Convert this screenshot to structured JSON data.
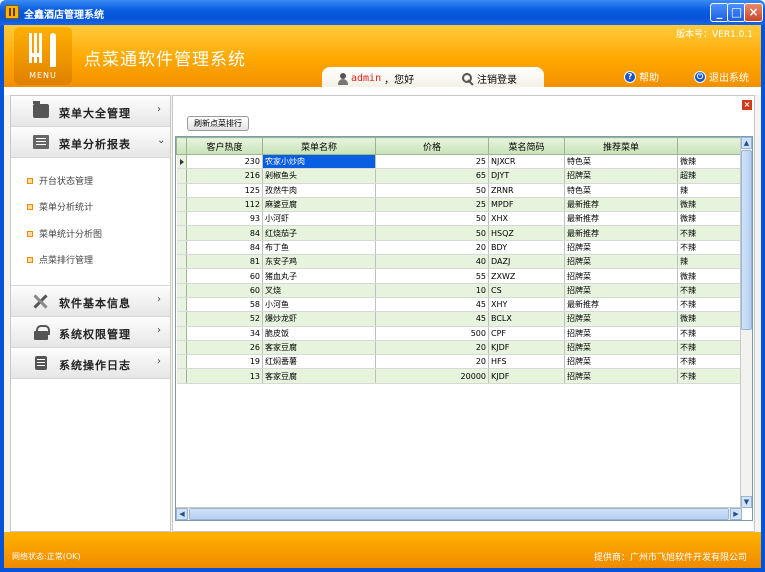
{
  "window": {
    "title": "全鑫酒店管理系统",
    "min": "_",
    "max": "□",
    "close": "×"
  },
  "header": {
    "app_title": "点菜通软件管理系统",
    "version": "版本号：VER1.0.1",
    "user_name": "admin",
    "user_greeting": "，您好",
    "logout": "注销登录",
    "help": "帮助",
    "exit": "退出系统",
    "logo_text": "MENU"
  },
  "sidebar": {
    "sections": [
      {
        "label": "菜单大全管理",
        "chevron": "›"
      },
      {
        "label": "菜单分析报表",
        "chevron": "⌄"
      },
      {
        "label": "软件基本信息",
        "chevron": "›"
      },
      {
        "label": "系统权限管理",
        "chevron": "›"
      },
      {
        "label": "系统操作日志",
        "chevron": "›"
      }
    ],
    "sub_items": [
      "开台状态管理",
      "菜单分析统计",
      "菜单统计分析图",
      "点菜排行管理"
    ]
  },
  "main": {
    "refresh_button": "刷新点菜排行",
    "close": "×",
    "columns": [
      "客户热度",
      "菜单名称",
      "价格",
      "菜名简码",
      "推荐菜单",
      ""
    ],
    "rows": [
      [
        "230",
        "农家小炒肉",
        "25",
        "NJXCR",
        "特色菜",
        "微辣"
      ],
      [
        "216",
        "剁椒鱼头",
        "65",
        "DJYT",
        "招牌菜",
        "超辣"
      ],
      [
        "125",
        "孜然牛肉",
        "50",
        "ZRNR",
        "特色菜",
        "辣"
      ],
      [
        "112",
        "麻婆豆腐",
        "25",
        "MPDF",
        "最新推荐",
        "微辣"
      ],
      [
        "93",
        "小河虾",
        "50",
        "XHX",
        "最新推荐",
        "微辣"
      ],
      [
        "84",
        "红烧茄子",
        "50",
        "HSQZ",
        "最新推荐",
        "不辣"
      ],
      [
        "84",
        "布丁鱼",
        "20",
        "BDY",
        "招牌菜",
        "不辣"
      ],
      [
        "81",
        "东安子鸡",
        "40",
        "DAZJ",
        "招牌菜",
        "辣"
      ],
      [
        "60",
        "猪血丸子",
        "55",
        "ZXWZ",
        "招牌菜",
        "微辣"
      ],
      [
        "60",
        "叉烧",
        "10",
        "CS",
        "招牌菜",
        "不辣"
      ],
      [
        "58",
        "小河鱼",
        "45",
        "XHY",
        "最新推荐",
        "不辣"
      ],
      [
        "52",
        "爆炒龙虾",
        "45",
        "BCLX",
        "招牌菜",
        "微辣"
      ],
      [
        "34",
        "脆皮饭",
        "500",
        "CPF",
        "招牌菜",
        "不辣"
      ],
      [
        "26",
        "客家豆腐",
        "20",
        "KJDF",
        "招牌菜",
        "不辣"
      ],
      [
        "19",
        "红焖番薯",
        "20",
        "HFS",
        "招牌菜",
        "不辣"
      ],
      [
        "13",
        "客家豆腐",
        "20000",
        "KJDF",
        "招牌菜",
        "不辣"
      ]
    ]
  },
  "footer": {
    "status": "网络状态:正常(OK)",
    "provider": "提供商：广州市飞旭软件开发有限公司"
  },
  "colors": {
    "accent": "#ffa800",
    "title_blue": "#0553d8",
    "row_alt": "#e6f3dd",
    "selection": "#0a5ee0"
  }
}
